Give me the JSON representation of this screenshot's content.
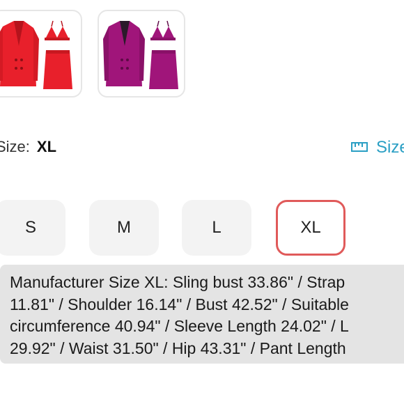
{
  "thumbnails": [
    {
      "name": "red-suit-set",
      "color": "#e8202b"
    },
    {
      "name": "purple-suit-set",
      "color": "#a0157a"
    }
  ],
  "size": {
    "label": "Size:",
    "value": "XL"
  },
  "size_guide": {
    "label": "Size",
    "icon": "ruler-icon"
  },
  "size_options": [
    {
      "label": "S",
      "selected": false
    },
    {
      "label": "M",
      "selected": false
    },
    {
      "label": "L",
      "selected": false
    },
    {
      "label": "XL",
      "selected": true
    }
  ],
  "accent_color": "#e05a5a",
  "link_color": "#2a9fc4",
  "description_lines": [
    "Manufacturer Size XL: Sling bust  33.86\" / Strap",
    "11.81\" / Shoulder 16.14\" / Bust 42.52\" / Suitable",
    "circumference  40.94\" / Sleeve Length 24.02\" / L",
    "29.92\" / Waist 31.50\" / Hip 43.31\" / Pant Length"
  ]
}
